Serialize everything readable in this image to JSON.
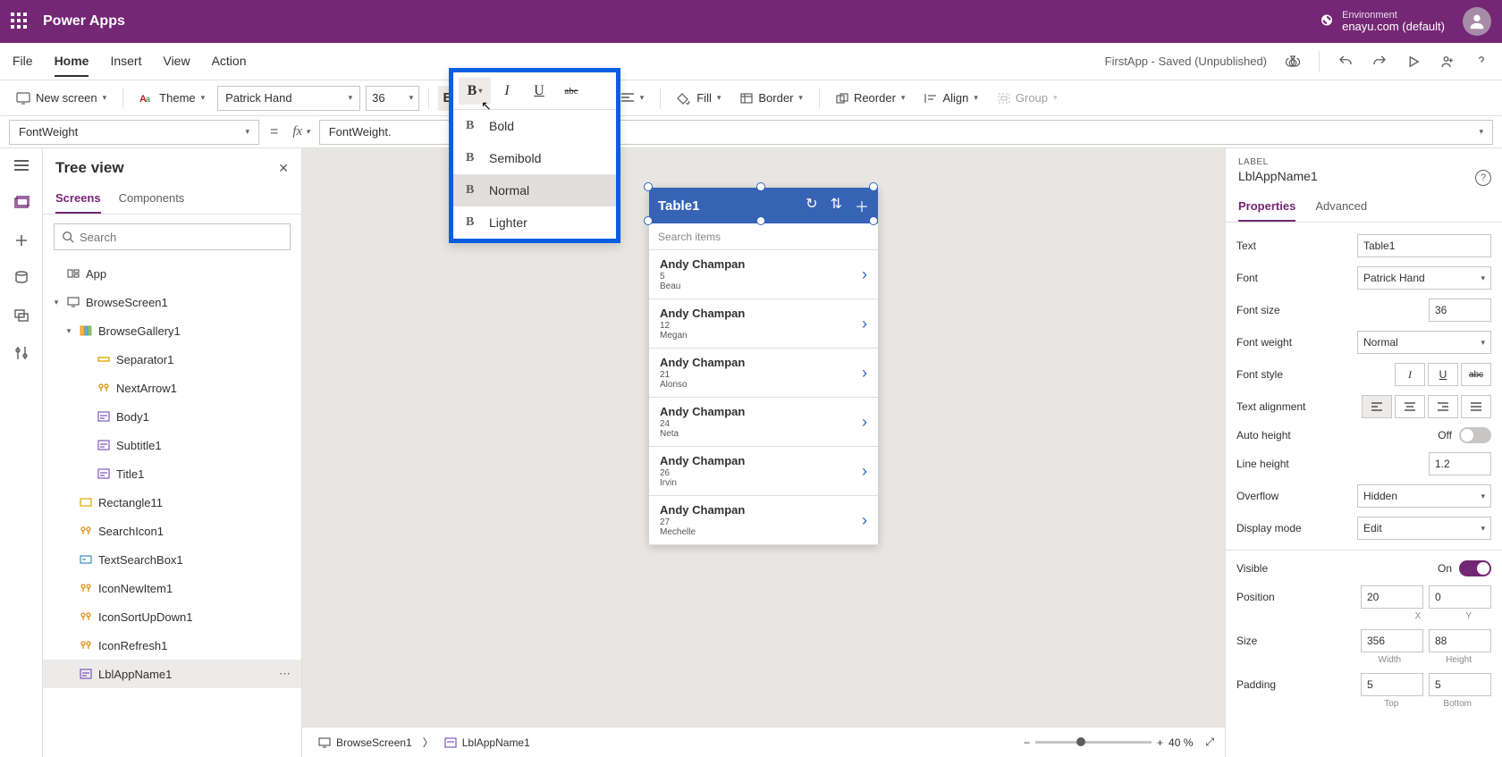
{
  "brand": "Power Apps",
  "environment": {
    "label": "Environment",
    "name": "enayu.com (default)"
  },
  "menu": {
    "items": [
      "File",
      "Home",
      "Insert",
      "View",
      "Action"
    ],
    "active": "Home",
    "status": "FirstApp - Saved (Unpublished)"
  },
  "ribbon": {
    "new_screen": "New screen",
    "theme": "Theme",
    "font": "Patrick Hand",
    "size": "36",
    "fill": "Fill",
    "border": "Border",
    "reorder": "Reorder",
    "align": "Align",
    "group": "Group"
  },
  "weight_menu": {
    "options": [
      "Bold",
      "Semibold",
      "Normal",
      "Lighter"
    ],
    "selected": "Normal"
  },
  "formula": {
    "property": "FontWeight",
    "value": "FontWeight."
  },
  "tree": {
    "title": "Tree view",
    "tabs": [
      "Screens",
      "Components"
    ],
    "active_tab": "Screens",
    "search_placeholder": "Search",
    "nodes": [
      {
        "label": "App",
        "indent": 0,
        "icon": "app"
      },
      {
        "label": "BrowseScreen1",
        "indent": 0,
        "icon": "screen",
        "chev": "▾"
      },
      {
        "label": "BrowseGallery1",
        "indent": 1,
        "icon": "gallery",
        "chev": "▾"
      },
      {
        "label": "Separator1",
        "indent": 2,
        "icon": "sep"
      },
      {
        "label": "NextArrow1",
        "indent": 2,
        "icon": "arrow"
      },
      {
        "label": "Body1",
        "indent": 2,
        "icon": "label"
      },
      {
        "label": "Subtitle1",
        "indent": 2,
        "icon": "label"
      },
      {
        "label": "Title1",
        "indent": 2,
        "icon": "label"
      },
      {
        "label": "Rectangle11",
        "indent": 1,
        "icon": "rect"
      },
      {
        "label": "SearchIcon1",
        "indent": 1,
        "icon": "arrow"
      },
      {
        "label": "TextSearchBox1",
        "indent": 1,
        "icon": "text"
      },
      {
        "label": "IconNewItem1",
        "indent": 1,
        "icon": "arrow"
      },
      {
        "label": "IconSortUpDown1",
        "indent": 1,
        "icon": "arrow"
      },
      {
        "label": "IconRefresh1",
        "indent": 1,
        "icon": "arrow"
      },
      {
        "label": "LblAppName1",
        "indent": 1,
        "icon": "label",
        "selected": true
      }
    ]
  },
  "phone": {
    "title": "Table1",
    "search_placeholder": "Search items",
    "rows": [
      {
        "name": "Andy Champan",
        "num": "5",
        "sub": "Beau"
      },
      {
        "name": "Andy Champan",
        "num": "12",
        "sub": "Megan"
      },
      {
        "name": "Andy Champan",
        "num": "21",
        "sub": "Alonso"
      },
      {
        "name": "Andy Champan",
        "num": "24",
        "sub": "Neta"
      },
      {
        "name": "Andy Champan",
        "num": "26",
        "sub": "Irvin"
      },
      {
        "name": "Andy Champan",
        "num": "27",
        "sub": "Mechelle"
      }
    ]
  },
  "props": {
    "kind": "LABEL",
    "name": "LblAppName1",
    "tabs": [
      "Properties",
      "Advanced"
    ],
    "active_tab": "Properties",
    "text_label": "Text",
    "text_value": "Table1",
    "font_label": "Font",
    "font_value": "Patrick Hand",
    "fontsize_label": "Font size",
    "fontsize_value": "36",
    "fontweight_label": "Font weight",
    "fontweight_value": "Normal",
    "fontstyle_label": "Font style",
    "align_label": "Text alignment",
    "autoheight_label": "Auto height",
    "autoheight_value": "Off",
    "lineheight_label": "Line height",
    "lineheight_value": "1.2",
    "overflow_label": "Overflow",
    "overflow_value": "Hidden",
    "display_label": "Display mode",
    "display_value": "Edit",
    "visible_label": "Visible",
    "visible_value": "On",
    "position_label": "Position",
    "position_x": "20",
    "position_y": "0",
    "x_label": "X",
    "y_label": "Y",
    "size_label": "Size",
    "size_w": "356",
    "size_h": "88",
    "w_label": "Width",
    "h_label": "Height",
    "padding_label": "Padding",
    "pad_top": "5",
    "pad_bottom": "5",
    "top_label": "Top",
    "bottom_label": "Bottom"
  },
  "breadcrumb": {
    "screen": "BrowseScreen1",
    "element": "LblAppName1"
  },
  "zoom": {
    "value": "40",
    "unit": "%"
  }
}
